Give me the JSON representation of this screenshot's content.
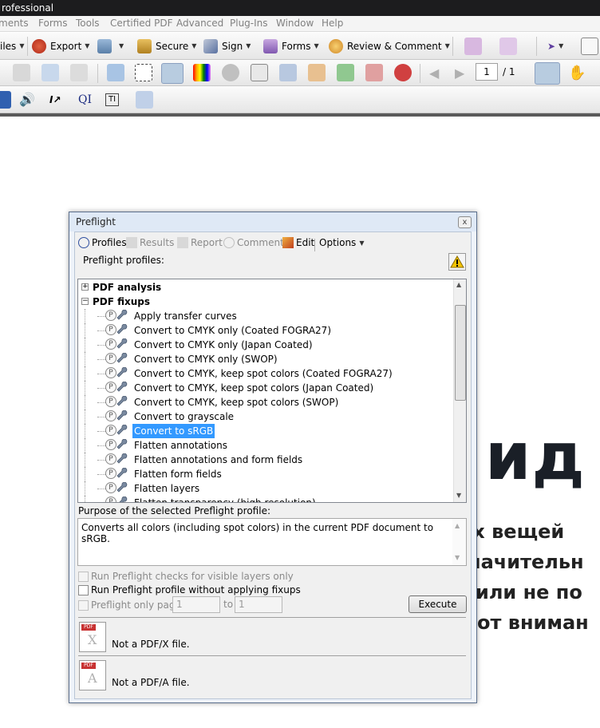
{
  "window": {
    "title": "rofessional"
  },
  "menu": [
    "ments",
    "Forms",
    "Tools",
    "Certified PDF",
    "Advanced",
    "Plug-Ins",
    "Window",
    "Help"
  ],
  "toolbar1": {
    "files": "iles",
    "export": "Export",
    "secure": "Secure",
    "sign": "Sign",
    "forms": "Forms",
    "review": "Review & Comment"
  },
  "nav": {
    "page": "1",
    "total": "/ 1"
  },
  "toolbar3": {
    "ql": "QI",
    "text": "TI"
  },
  "background": {
    "heading": "и ид",
    "lines": [
      "ех вещей",
      "начительн",
      "или  не  по",
      "от вниман"
    ]
  },
  "dialog": {
    "title": "Preflight",
    "close": "x",
    "tabs": {
      "profiles": "Profiles",
      "results": "Results",
      "report": "Report",
      "comments": "Comments",
      "edit": "Edit",
      "options": "Options"
    },
    "profiles_label": "Preflight profiles:",
    "tree": {
      "groups": [
        {
          "label": "PDF analysis",
          "expander": "+"
        },
        {
          "label": "PDF fixups",
          "expander": "−"
        }
      ],
      "items": [
        "Apply transfer curves",
        "Convert to CMYK only (Coated FOGRA27)",
        "Convert to CMYK only (Japan Coated)",
        "Convert to CMYK only (SWOP)",
        "Convert to CMYK, keep spot colors (Coated FOGRA27)",
        "Convert to CMYK, keep spot colors (Japan Coated)",
        "Convert to CMYK, keep spot colors (SWOP)",
        "Convert to grayscale",
        "Convert to sRGB",
        "Flatten annotations",
        "Flatten annotations and form fields",
        "Flatten form fields",
        "Flatten layers",
        "Flatten transparency (high resolution)"
      ],
      "selected": "Convert to sRGB"
    },
    "purpose_label": "Purpose of the selected Preflight profile:",
    "purpose_text": "Converts all colors (including spot colors) in the current PDF document to sRGB.",
    "options": {
      "visible_layers": "Run Preflight checks for visible layers only",
      "without_fixups": "Run Preflight profile without applying fixups",
      "pages_only": "Preflight only pages",
      "from": "1",
      "to_label": "to",
      "to": "1"
    },
    "execute": "Execute",
    "pdfx": {
      "tag": "PDF",
      "letter": "X",
      "text": "Not a PDF/X file."
    },
    "pdfa": {
      "tag": "PDF",
      "letter": "A",
      "text": "Not a PDF/A file."
    }
  }
}
